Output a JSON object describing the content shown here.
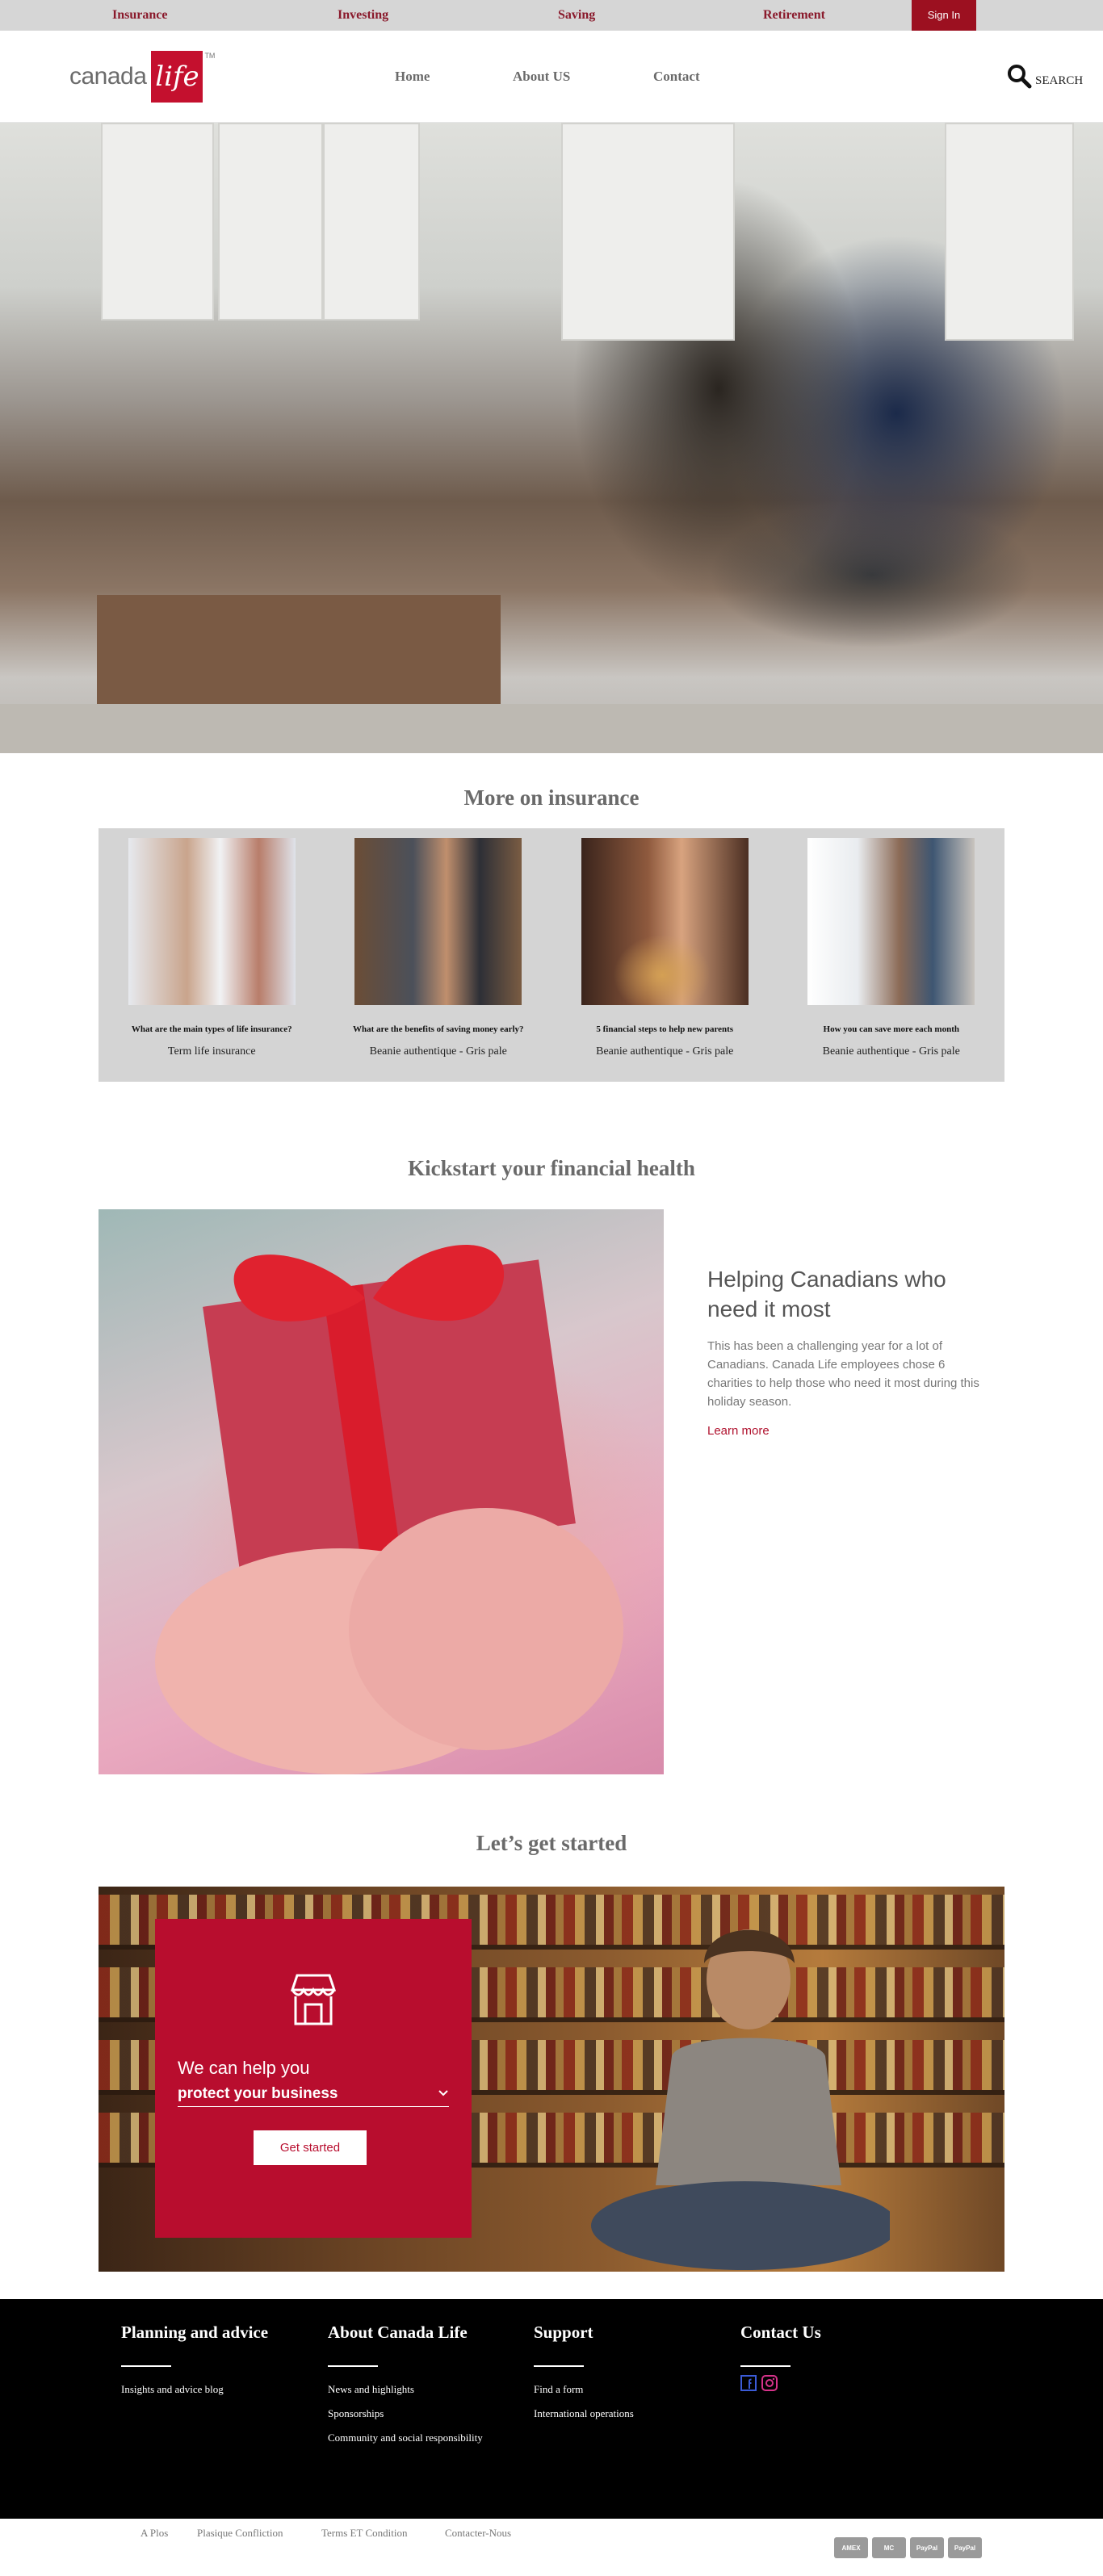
{
  "topbar": {
    "links": [
      "Insurance",
      "Investing",
      "Saving",
      "Retirement"
    ],
    "signin": "Sign In"
  },
  "header": {
    "logo_word": "canada",
    "logo_box": "life",
    "logo_tm": "TM",
    "nav": [
      "Home",
      "About US",
      "Contact"
    ],
    "search_label": "SEARCH"
  },
  "more": {
    "title": "More on insurance",
    "cards": [
      {
        "question": "What are the main types of life insurance?",
        "sub": "Term life insurance"
      },
      {
        "question": "What are the benefits of saving money early?",
        "sub": "Beanie authentique - Gris pale"
      },
      {
        "question": "5 financial steps to help new parents",
        "sub": "Beanie authentique - Gris pale"
      },
      {
        "question": "How you can save more each month",
        "sub": "Beanie authentique - Gris pale"
      }
    ]
  },
  "kickstart": {
    "title": "Kickstart your financial health",
    "heading": "Helping Canadians who need it most",
    "body": "This has been a challenging year for a lot of Canadians. Canada Life employees chose 6 charities to help those who need it most during this holiday season.",
    "link": "Learn more"
  },
  "start": {
    "title": "Let’s get started",
    "help_text": "We can help you",
    "selected": "protect your business",
    "button": "Get started"
  },
  "footer": {
    "columns": [
      {
        "title": "Planning and advice",
        "links": [
          "Insights and advice blog"
        ]
      },
      {
        "title": "About Canada Life",
        "links": [
          "News and highlights",
          "Sponsorships",
          "Community and social responsibility"
        ]
      },
      {
        "title": "Support",
        "links": [
          "Find a form",
          "International operations"
        ]
      },
      {
        "title": "Contact Us",
        "links": []
      }
    ]
  },
  "bottom": {
    "links": [
      "A Plos",
      "Plasique Confliction",
      "Terms ET Condition",
      "Contacter-Nous"
    ],
    "payments": [
      "AMEX",
      "MC",
      "PayPal",
      "PayPal"
    ]
  },
  "colors": {
    "brand_red": "#c4102e",
    "topbar_bg": "#d6d6d6",
    "footer_bg": "#000000"
  }
}
